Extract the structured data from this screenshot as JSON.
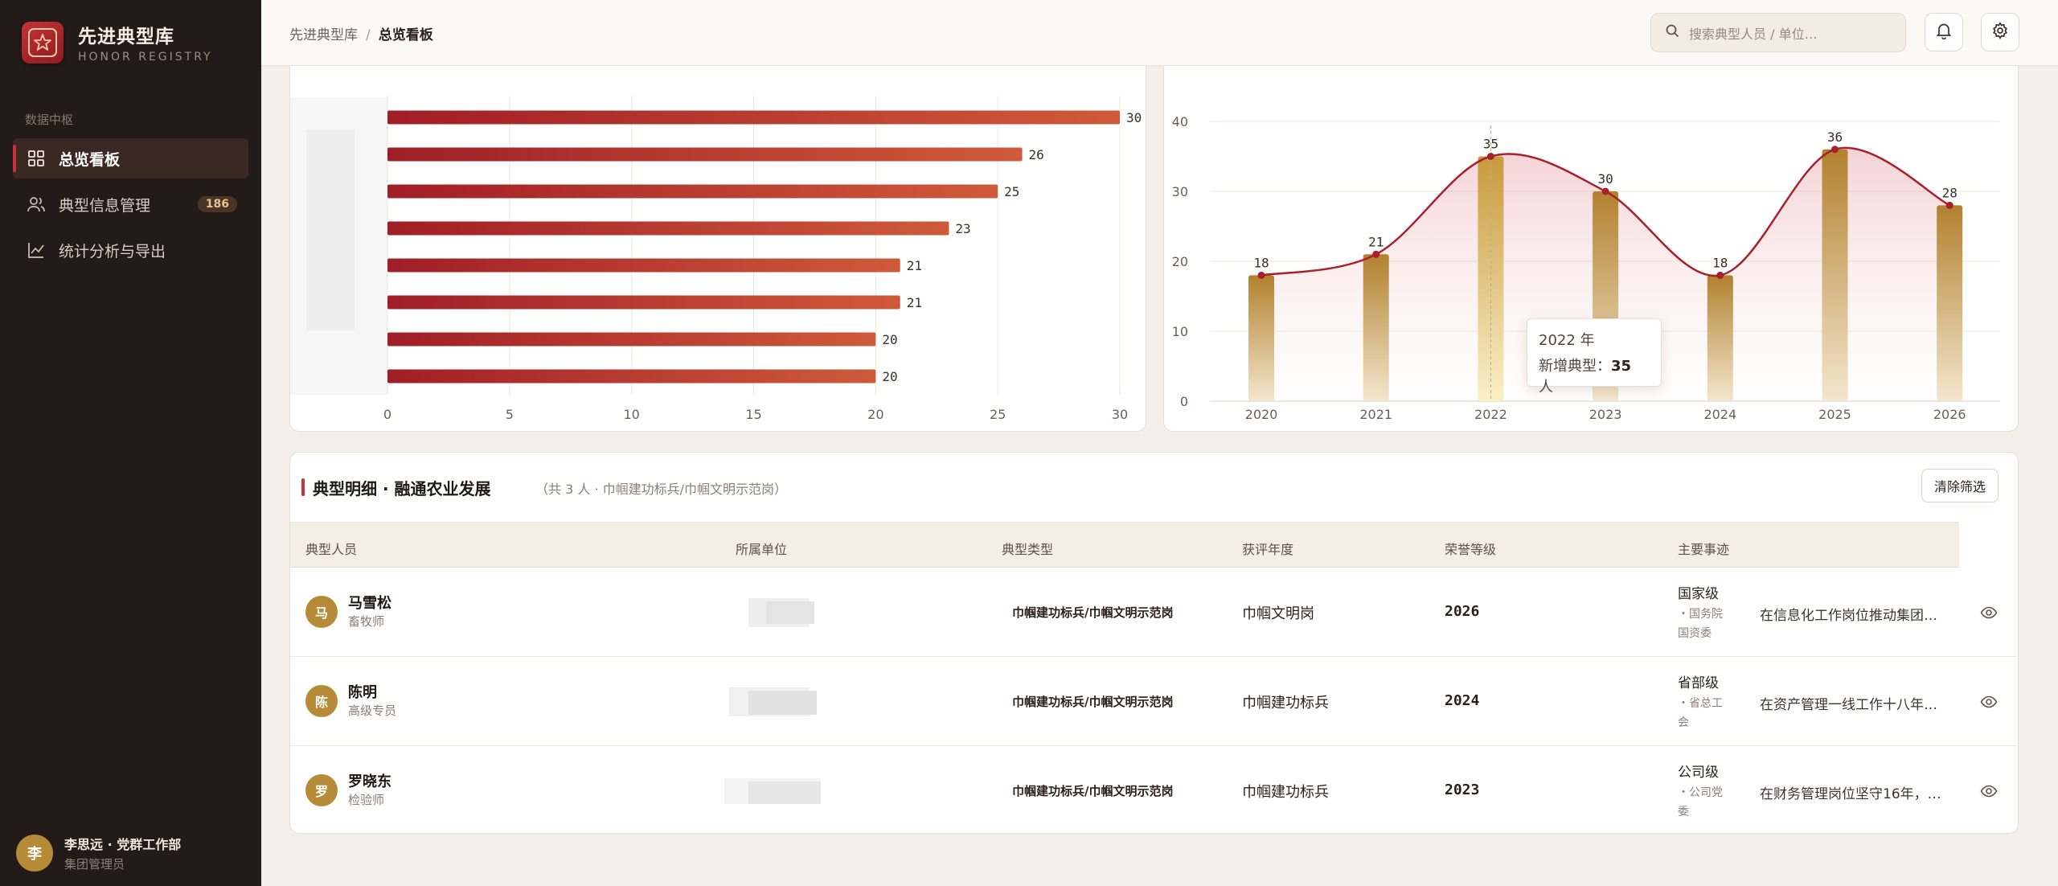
{
  "sidebar": {
    "brand_title": "先进典型库",
    "brand_sub": "HONOR REGISTRY",
    "group_label": "数据中枢",
    "items": [
      {
        "label": "总览看板",
        "icon": "dashboard-icon",
        "active": true
      },
      {
        "label": "典型信息管理",
        "icon": "users-icon",
        "badge": "186"
      },
      {
        "label": "统计分析与导出",
        "icon": "chart-line-icon"
      }
    ],
    "user": {
      "avatar": "李",
      "name": "李思远 · 党群工作部",
      "role": "集团管理员"
    }
  },
  "topbar": {
    "breadcrumb_root": "先进典型库",
    "breadcrumb_sep": "/",
    "breadcrumb_current": "总览看板",
    "search_placeholder": "搜索典型人员 / 单位…",
    "icons": [
      "bell-icon",
      "gear-icon"
    ]
  },
  "chart_data": [
    {
      "type": "bar",
      "orientation": "horizontal",
      "categories": [
        "",
        "",
        "",
        "",
        "",
        "",
        "",
        ""
      ],
      "values": [
        30,
        26,
        25,
        23,
        21,
        21,
        20,
        20
      ],
      "xticks": [
        "0",
        "5",
        "10",
        "15",
        "20",
        "25",
        "30"
      ],
      "xlim": [
        0,
        30
      ],
      "grid": true
    },
    {
      "type": "bar",
      "overlay": "line",
      "x": [
        "2020",
        "2021",
        "2022",
        "2023",
        "2024",
        "2025",
        "2026"
      ],
      "values": [
        18,
        21,
        35,
        30,
        18,
        36,
        28
      ],
      "yticks": [
        "0",
        "10",
        "20",
        "30",
        "40"
      ],
      "ylim": [
        0,
        40
      ],
      "grid": true,
      "highlight_index": 2,
      "colors": {
        "bar": "#b98a3e",
        "line": "#a8202b"
      }
    }
  ],
  "tooltip": {
    "title": "2022 年",
    "label": "新增典型：",
    "value": "35",
    "unit": " 人"
  },
  "table": {
    "title": "典型明细 · 融通农业发展",
    "subtitle": "（共 3 人 · 巾帼建功标兵/巾帼文明示范岗）",
    "clear_label": "清除筛选",
    "columns": [
      "典型人员",
      "所属单位",
      "典型类型",
      "获评年度",
      "荣誉等级",
      "主要事迹"
    ],
    "rows": [
      {
        "avatar": "马",
        "name": "马雪松",
        "job": "畜牧师",
        "type": "巾帼建功标兵/巾帼文明示范岗",
        "honor": "巾帼文明岗",
        "year": "2026",
        "level": "国家级",
        "org": "・国务院国资委",
        "deed": "在信息化工作岗位推动集团…"
      },
      {
        "avatar": "陈",
        "name": "陈明",
        "job": "高级专员",
        "type": "巾帼建功标兵/巾帼文明示范岗",
        "honor": "巾帼建功标兵",
        "year": "2024",
        "level": "省部级",
        "org": "・省总工会",
        "deed": "在资产管理一线工作十八年…"
      },
      {
        "avatar": "罗",
        "name": "罗晓东",
        "job": "检验师",
        "type": "巾帼建功标兵/巾帼文明示范岗",
        "honor": "巾帼建功标兵",
        "year": "2023",
        "level": "公司级",
        "org": "・公司党委",
        "deed": "在财务管理岗位坚守16年，…"
      }
    ]
  },
  "colors": {
    "accent": "#c8323a",
    "gold": "#b68a36",
    "sidebar": "#231b17"
  }
}
